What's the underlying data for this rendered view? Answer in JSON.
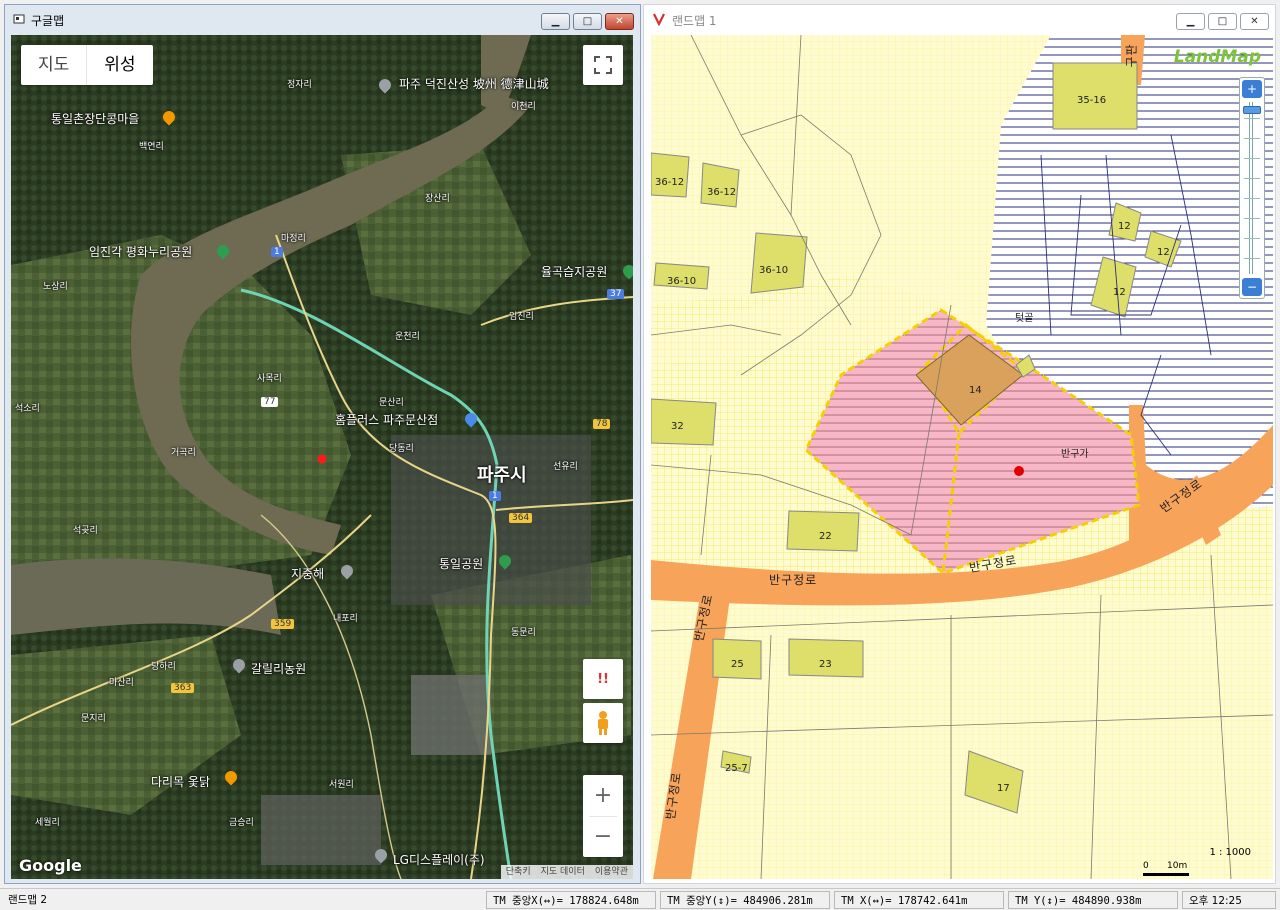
{
  "google_window": {
    "title": "구글맵",
    "map_types": [
      "지도",
      "위성"
    ],
    "active_map_type": "위성",
    "brand": "Google",
    "footer": [
      "단축키",
      "지도 데이터",
      "이용약관"
    ],
    "places": [
      "파주 덕진산성 坡州 德津山城",
      "통일촌장단콩마을",
      "임진각 평화누리공원",
      "율곡습지공원",
      "홈플러스 파주문산점",
      "파주시",
      "통일공원",
      "지중해",
      "갈릴리농원",
      "다리목 옻닭",
      "LG디스플레이(주)"
    ],
    "small_labels": [
      "정자리",
      "백연리",
      "마정리",
      "장산리",
      "당동리",
      "문산리",
      "이천리",
      "선유리",
      "내포리",
      "당하리",
      "문지리",
      "서원리",
      "금승리",
      "세월리",
      "노상리",
      "거곡리",
      "석곶리",
      "동문리",
      "임진리",
      "운천리",
      "사목리",
      "마산리",
      "석소리"
    ],
    "route_numbers": [
      "1",
      "37",
      "77",
      "78",
      "364",
      "359",
      "363",
      "1"
    ],
    "extra_icons": [
      "!!"
    ]
  },
  "land_window": {
    "title": "랜드맵 1",
    "logo": "LandMap",
    "parcels": [
      "35-16",
      "36-12",
      "36-12",
      "36-10",
      "36-10",
      "12",
      "12",
      "12",
      "32",
      "14",
      "22",
      "25",
      "23",
      "25-7",
      "17"
    ],
    "area_labels": [
      "텃골",
      "반구가"
    ],
    "roads": [
      "반구정로",
      "반구정로",
      "반구정로",
      "반구정로",
      "반구정로"
    ],
    "road_top": "구판",
    "scale_text": "1 : 1000",
    "scale_marks": [
      "0",
      "10m"
    ]
  },
  "statusbar": {
    "left": "랜드맵 2",
    "tm_center_x": "TM 중앙X(↔)= 178824.648m",
    "tm_center_y": "TM 중앙Y(↕)= 484906.281m",
    "tm_x": "TM X(↔)= 178742.641m",
    "tm_y": "TM Y(↕)= 484890.938m",
    "time": "오후 12:25"
  },
  "colors": {
    "parcel_fill": "#dede6a",
    "highlight_fill": "#f7b7c7",
    "road": "#f7a35a",
    "grid": "#f1ee6a"
  }
}
